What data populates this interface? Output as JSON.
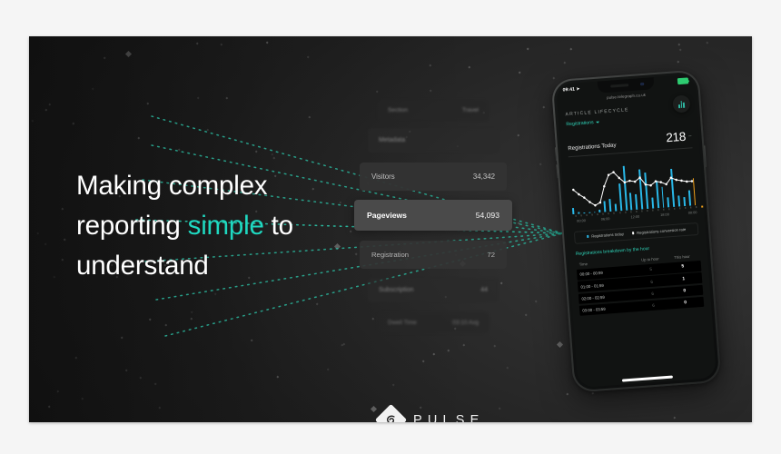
{
  "headline": {
    "line1": "Making complex",
    "line2_pre": "reporting ",
    "line2_accent": "simple",
    "line2_post": " to",
    "line3": "understand",
    "accent_color": "#1fd8c0"
  },
  "metrics": {
    "rows": [
      {
        "label": "Section",
        "value": "Travel",
        "state": "faded"
      },
      {
        "label": "Metadata",
        "value": "",
        "state": "faded"
      },
      {
        "label": "Visitors",
        "value": "34,342",
        "state": "normal"
      },
      {
        "label": "Pageviews",
        "value": "54,093",
        "state": "selected"
      },
      {
        "label": "Registration",
        "value": "72",
        "state": "normal"
      },
      {
        "label": "Subscription",
        "value": "44",
        "state": "faded"
      },
      {
        "label": "Dwell Time",
        "value": "03:10 Avg",
        "state": "faded"
      }
    ]
  },
  "phone": {
    "status": {
      "time": "09:41",
      "location_icon": "location-arrow-icon",
      "battery_icon": "battery-full-icon"
    },
    "url": "pulse.telegraph.co.uk",
    "kicker": "ARTICLE LIFECYCLE",
    "dropdown": "Registrations",
    "fab_icon": "bar-chart-icon",
    "kpi": {
      "label": "Registrations Today",
      "value": "218",
      "trend": "–"
    },
    "legend": [
      {
        "label": "Registrations today",
        "color": "#29b8e8"
      },
      {
        "label": "Registrations conversion rate",
        "color": "#ffffff"
      }
    ],
    "breakdown_title": "Registrations breakdown by the hour",
    "table": {
      "headers": [
        "Time",
        "Up to hour",
        "This hour"
      ],
      "rows": [
        [
          "00:00 - 00:59",
          "5",
          "5"
        ],
        [
          "01:00 - 01:59",
          "6",
          "1"
        ],
        [
          "02:00 - 02:59",
          "6",
          "0"
        ],
        [
          "03:00 - 03:59",
          "6",
          "0"
        ]
      ]
    }
  },
  "chart_data": {
    "type": "bar",
    "title": "Registrations today",
    "xlabel": "",
    "ylabel": "",
    "grid": false,
    "legend_position": "bottom",
    "x_ticks": [
      "00:00",
      "06:00",
      "12:00",
      "18:00",
      "00:00"
    ],
    "categories": [
      "00:00",
      "01:00",
      "02:00",
      "03:00",
      "04:00",
      "05:00",
      "06:00",
      "07:00",
      "08:00",
      "09:00",
      "10:00",
      "11:00",
      "12:00",
      "13:00",
      "14:00",
      "15:00",
      "16:00",
      "17:00",
      "18:00",
      "19:00",
      "20:00",
      "21:00",
      "22:00",
      "23:00"
    ],
    "series": [
      {
        "name": "Registrations today",
        "type": "bar",
        "color": "#29b8e8",
        "values": [
          5,
          1,
          0,
          0,
          0,
          2,
          9,
          10,
          6,
          22,
          36,
          14,
          12,
          32,
          29,
          9,
          22,
          17,
          8,
          31,
          9,
          7,
          12,
          22
        ],
        "highlight_index": 23,
        "highlight_color": "#f0a019"
      },
      {
        "name": "Registrations conversion rate",
        "type": "line",
        "color": "#ffffff",
        "values": [
          17,
          13,
          10,
          6,
          3,
          5,
          18,
          27,
          29,
          24,
          20,
          21,
          20,
          23,
          17,
          16,
          19,
          18,
          16,
          21,
          19,
          18,
          17,
          17
        ]
      }
    ],
    "ylim": [
      0,
      40
    ]
  },
  "logo": {
    "wordmark": "PULSE",
    "mark_icon": "pulse-diamond-icon"
  }
}
